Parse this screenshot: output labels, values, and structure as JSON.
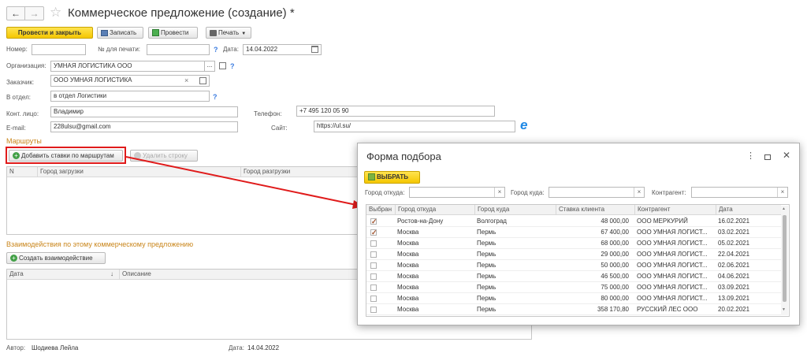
{
  "header": {
    "title": "Коммерческое предложение (создание) *"
  },
  "toolbar": {
    "post_close": "Провести и закрыть",
    "save": "Записать",
    "post": "Провести",
    "print": "Печать"
  },
  "form": {
    "number_label": "Номер:",
    "number_value": "",
    "print_no_label": "№ для печати:",
    "print_no_value": "",
    "date_label": "Дата:",
    "date_value": "14.04.2022",
    "org_label": "Организация:",
    "org_value": "УМНАЯ ЛОГИСТИКА ООО",
    "customer_label": "Заказчик:",
    "customer_value": "ООО УМНАЯ ЛОГИСТИКА",
    "dept_label": "В отдел:",
    "dept_value": "в отдел Логистики",
    "contact_label": "Конт. лицо:",
    "contact_value": "Владимир",
    "phone_label": "Телефон:",
    "phone_value": "+7 495 120 05 90",
    "email_label": "E-mail:",
    "email_value": "228ulsu@gmail.com",
    "site_label": "Сайт:",
    "site_value": "https://ul.su/",
    "help": "?"
  },
  "routes": {
    "section_title": "Маршруты",
    "add_button": "Добавить ставки по маршрутам",
    "delete_button": "Удалить строку",
    "columns": [
      "N",
      "Город загрузки",
      "Город разгрузки"
    ]
  },
  "interactions": {
    "section_title": "Взаимодействия по этому коммерческому предложению",
    "create_button": "Создать взаимодействие",
    "columns": [
      "Дата",
      "Описание"
    ]
  },
  "footer": {
    "author_label": "Автор:",
    "author_value": "Шодиева Лейла",
    "date_label": "Дата:",
    "date_value": "14.04.2022"
  },
  "modal": {
    "title": "Форма подбора",
    "select_button": "ВЫБРАТЬ",
    "from_label": "Город откуда:",
    "to_label": "Город куда:",
    "contractor_label": "Контрагент:",
    "columns": [
      "Выбран",
      "Город откуда",
      "Город куда",
      "Ставка клиента",
      "Контрагент",
      "Дата"
    ],
    "rows": [
      {
        "checked": true,
        "from": "Ростов-на-Дону",
        "to": "Волгоград",
        "rate": "48 000,00",
        "contractor": "ООО МЕРКУРИЙ",
        "date": "16.02.2021"
      },
      {
        "checked": true,
        "from": "Москва",
        "to": "Пермь",
        "rate": "67 400,00",
        "contractor": "ООО УМНАЯ ЛОГИСТ...",
        "date": "03.02.2021"
      },
      {
        "checked": false,
        "from": "Москва",
        "to": "Пермь",
        "rate": "68 000,00",
        "contractor": "ООО УМНАЯ ЛОГИСТ...",
        "date": "05.02.2021"
      },
      {
        "checked": false,
        "from": "Москва",
        "to": "Пермь",
        "rate": "29 000,00",
        "contractor": "ООО УМНАЯ ЛОГИСТ...",
        "date": "22.04.2021"
      },
      {
        "checked": false,
        "from": "Москва",
        "to": "Пермь",
        "rate": "50 000,00",
        "contractor": "ООО УМНАЯ ЛОГИСТ...",
        "date": "02.06.2021"
      },
      {
        "checked": false,
        "from": "Москва",
        "to": "Пермь",
        "rate": "46 500,00",
        "contractor": "ООО УМНАЯ ЛОГИСТ...",
        "date": "04.06.2021"
      },
      {
        "checked": false,
        "from": "Москва",
        "to": "Пермь",
        "rate": "75 000,00",
        "contractor": "ООО УМНАЯ ЛОГИСТ...",
        "date": "03.09.2021"
      },
      {
        "checked": false,
        "from": "Москва",
        "to": "Пермь",
        "rate": "80 000,00",
        "contractor": "ООО УМНАЯ ЛОГИСТ...",
        "date": "13.09.2021"
      },
      {
        "checked": false,
        "from": "Москва",
        "to": "Пермь",
        "rate": "358 170,80",
        "contractor": "РУССКИЙ ЛЕС ООО",
        "date": "20.02.2021"
      }
    ]
  },
  "colors": {
    "accent_yellow": "#f5c700",
    "highlight_red": "#e01b1b",
    "section_orange": "#c9851a",
    "link_blue": "#3a7be0"
  }
}
